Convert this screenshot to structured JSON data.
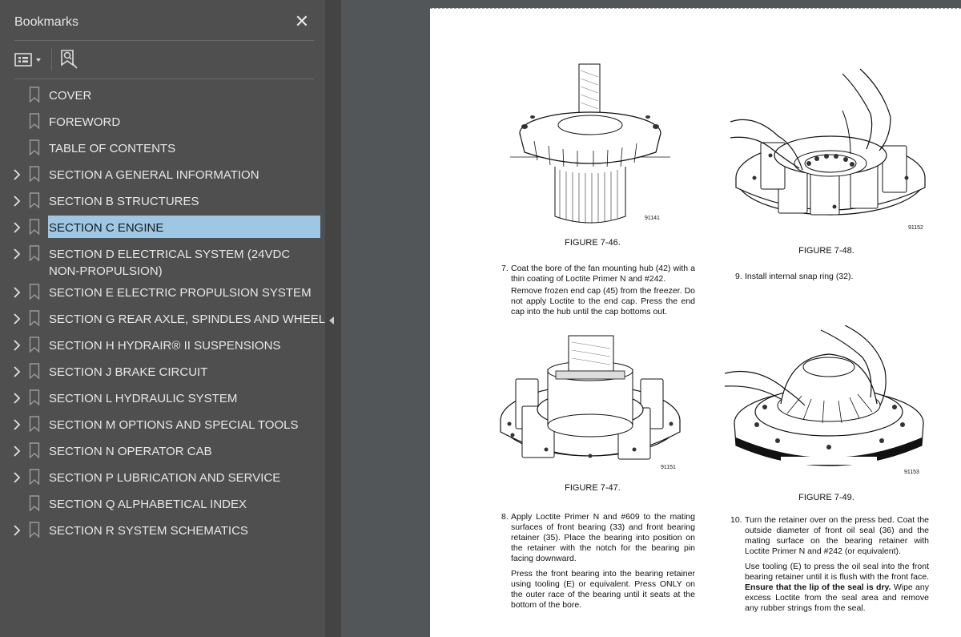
{
  "panel": {
    "title": "Bookmarks",
    "close_icon": "close-icon",
    "options_icon": "bookmark-options-icon",
    "find_icon": "find-current-bookmark-icon"
  },
  "bookmarks": [
    {
      "label": "COVER",
      "expandable": false,
      "selected": false
    },
    {
      "label": "FOREWORD",
      "expandable": false,
      "selected": false
    },
    {
      "label": "TABLE OF CONTENTS",
      "expandable": false,
      "selected": false
    },
    {
      "label": "SECTION A GENERAL INFORMATION",
      "expandable": true,
      "selected": false
    },
    {
      "label": "SECTION B STRUCTURES",
      "expandable": true,
      "selected": false
    },
    {
      "label": "SECTION C ENGINE",
      "expandable": true,
      "selected": true
    },
    {
      "label": "SECTION D ELECTRICAL SYSTEM (24VDC",
      "label2": "NON-PROPULSION)",
      "expandable": true,
      "selected": false
    },
    {
      "label": "SECTION E ELECTRIC PROPULSION SYSTEM",
      "expandable": true,
      "selected": false
    },
    {
      "label": "SECTION G REAR AXLE, SPINDLES AND WHEELS",
      "expandable": true,
      "selected": false
    },
    {
      "label": "SECTION H HYDRAIR® II SUSPENSIONS",
      "expandable": true,
      "selected": false
    },
    {
      "label": "SECTION J BRAKE CIRCUIT",
      "expandable": true,
      "selected": false
    },
    {
      "label": "SECTION L HYDRAULIC SYSTEM",
      "expandable": true,
      "selected": false
    },
    {
      "label": "SECTION M OPTIONS AND SPECIAL TOOLS",
      "expandable": true,
      "selected": false
    },
    {
      "label": "SECTION N OPERATOR CAB",
      "expandable": true,
      "selected": false
    },
    {
      "label": "SECTION P LUBRICATION AND SERVICE",
      "expandable": true,
      "selected": false
    },
    {
      "label": "SECTION Q ALPHABETICAL INDEX",
      "expandable": false,
      "selected": false
    },
    {
      "label": "SECTION R SYSTEM SCHEMATICS",
      "expandable": true,
      "selected": false
    }
  ],
  "document": {
    "figures": [
      {
        "caption": "FIGURE 7-46.",
        "number": "91141"
      },
      {
        "caption": "FIGURE 7-48.",
        "number": "91152"
      },
      {
        "caption": "FIGURE 7-47.",
        "number": "91151"
      },
      {
        "caption": "FIGURE 7-49.",
        "number": "91153"
      }
    ],
    "step7": {
      "num": "7.",
      "p1": "Coat the bore of the fan mounting hub (42) with a thin coating of Loctite Primer N and #242.",
      "p2": "Remove frozen end cap (45) from the freezer. Do not apply Loctite to the end cap. Press the end cap into the hub until the cap bottoms out."
    },
    "step9": {
      "num": "9.",
      "p1": "Install internal snap ring (32)."
    },
    "step8": {
      "num": "8.",
      "p1": "Apply Loctite Primer N and #609 to the mating surfaces of front bearing (33) and front bearing retainer (35). Place the bearing into position on the retainer with the notch for the bearing pin facing downward.",
      "p2": "Press the front bearing into the bearing retainer using tooling (E) or equivalent. Press ONLY on the outer race of the bearing until it seats at the bottom of the bore."
    },
    "step10": {
      "num": "10.",
      "p1": "Turn the retainer over on the press bed. Coat the outside diameter of front oil seal (36) and the mating surface on the bearing retainer with Loctite Primer N and #242 (or equivalent).",
      "p2a": "Use tooling (E) to press the oil seal into the front bearing retainer until it is flush with the front face.",
      "p2b": "Ensure that the lip of the seal is dry.",
      "p2c": "Wipe any excess Loctite from the seal area and remove any rubber strings from the seal."
    }
  }
}
